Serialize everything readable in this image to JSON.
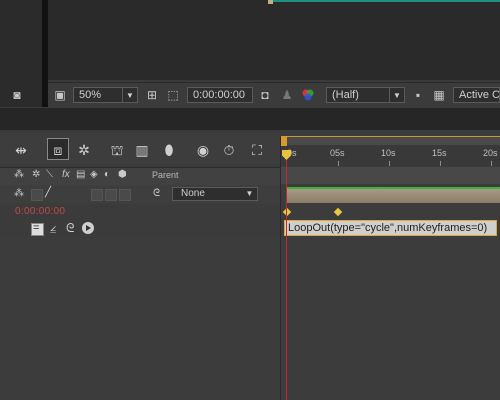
{
  "viewer": {
    "zoom": "50%",
    "timecode": "0:00:00:00",
    "resolution": "(Half)",
    "active_camera": "Active C"
  },
  "timeline": {
    "current_time": "0:00:00:00",
    "parent_header": "Parent",
    "parent_value": "None",
    "fx_label": "fx",
    "ruler_ticks": [
      "0s",
      "05s",
      "10s",
      "15s",
      "20s"
    ],
    "expression": "LoopOut(type=\"cycle\",numKeyframes=0)"
  },
  "colors": {
    "playhead": "#c22a2a",
    "keyframe": "#e8c83c",
    "time_readout": "#c24848",
    "expression_border": "#e0a830",
    "layer_top_line": "#3cb33c"
  }
}
